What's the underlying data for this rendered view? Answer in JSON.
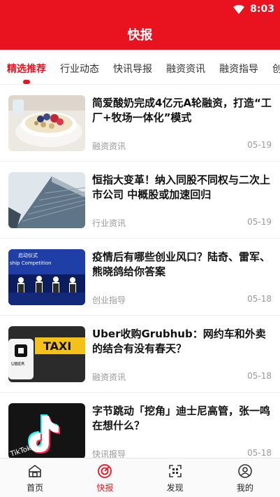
{
  "status_bar": {
    "time": "8:03"
  },
  "header": {
    "title": "快报"
  },
  "tabs": [
    {
      "label": "精选推荐"
    },
    {
      "label": "行业动态"
    },
    {
      "label": "快讯导报"
    },
    {
      "label": "融资资讯"
    },
    {
      "label": "融资指导"
    },
    {
      "label": "创"
    }
  ],
  "news": [
    {
      "headline": "简爱酸奶完成4亿元A轮融资，打造“工厂+牧场一体化”模式",
      "category": "融资资讯",
      "date": "05-19",
      "thumb": "yogurt-bowl-image"
    },
    {
      "headline": "恒指大变革！纳入同股不同权与二次上市公司 中概股或加速回归",
      "category": "行业资讯",
      "date": "05-19",
      "thumb": "skyscraper-image"
    },
    {
      "headline": "疫情后有哪些创业风口？陆奇、雷军、熊晓鸽给你答案",
      "category": "创业指导",
      "date": "05-18",
      "thumb": "stage-panel-image"
    },
    {
      "headline": "Uber收购Grubhub：网约车和外卖的结合有没有春天？",
      "category": "融资资讯",
      "date": "05-18",
      "thumb": "uber-taxi-image"
    },
    {
      "headline": "字节跳动「挖角」迪士尼高管，张一鸣在想什么？",
      "category": "快讯报导",
      "date": "05-18",
      "thumb": "tiktok-image"
    }
  ],
  "image_text": {
    "stage_sign": "ship Competition",
    "stage_sign_top": "启动仪式",
    "uber_wordmark": "UBER",
    "taxi_sign": "TAXI",
    "tiktok_wordmark": "TikTok"
  },
  "bottom_nav": [
    {
      "label": "首页",
      "icon": "home-icon"
    },
    {
      "label": "快报",
      "icon": "express-icon"
    },
    {
      "label": "发现",
      "icon": "scan-icon"
    },
    {
      "label": "我的",
      "icon": "profile-icon"
    }
  ],
  "colors": {
    "brand": "#e8131f",
    "text": "#111111",
    "meta": "#999999"
  }
}
